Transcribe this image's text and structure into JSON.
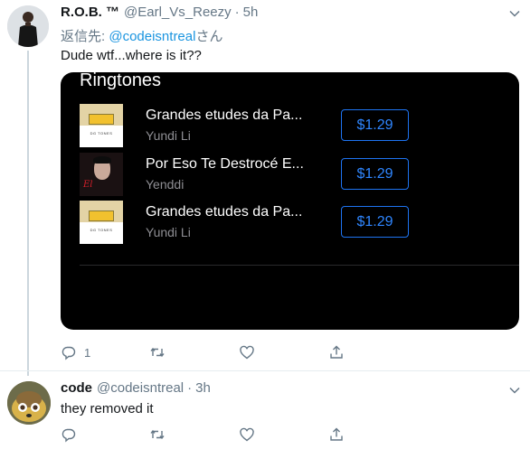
{
  "tweets": [
    {
      "display_name": "R.O.B. ™",
      "handle": "@Earl_Vs_Reezy",
      "separator": "·",
      "time": "5h",
      "reply_prefix": "返信先: ",
      "reply_mention": "@codeisntreal",
      "reply_suffix": "さん",
      "text": "Dude wtf...where is it??",
      "reply_count": "1",
      "media": {
        "title": "Ringtones",
        "tracks": [
          {
            "title": "Grandes etudes da Pa...",
            "artist": "Yundi Li",
            "price": "$1.29",
            "art_text": "DG TONES"
          },
          {
            "title": "Por Eso Te Destrocé E...",
            "artist": "Yenddi",
            "price": "$1.29",
            "art_text": "El"
          },
          {
            "title": "Grandes etudes da Pa...",
            "artist": "Yundi Li",
            "price": "$1.29",
            "art_text": "DG TONES"
          }
        ]
      }
    },
    {
      "display_name": "code",
      "handle": "@codeisntreal",
      "separator": "·",
      "time": "3h",
      "text": "they removed it"
    }
  ],
  "colors": {
    "link": "#1b95e0",
    "secondary_text": "#657786",
    "price_blue": "#2f86ff",
    "media_bg": "#000000"
  },
  "icons": [
    "chevron-down-icon",
    "reply-icon",
    "retweet-icon",
    "like-icon",
    "share-icon"
  ]
}
